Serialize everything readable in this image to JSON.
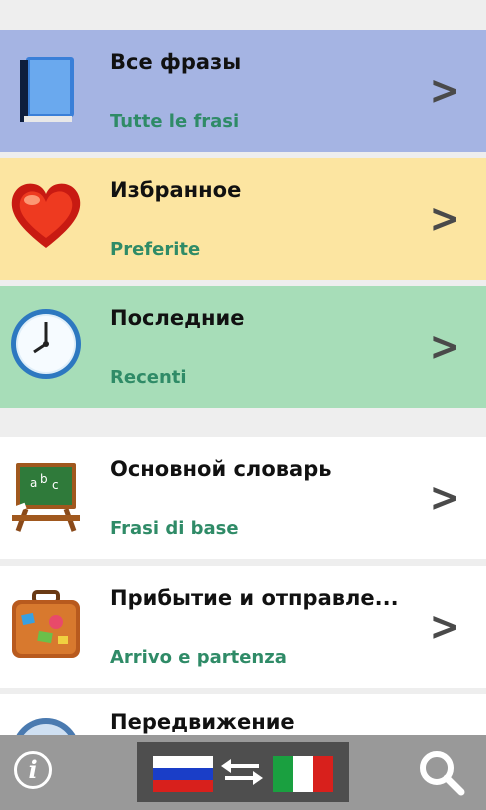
{
  "list": [
    {
      "title": "Все фразы",
      "subtitle": "Tutte le frasi",
      "icon": "book-icon"
    },
    {
      "title": "Избранное",
      "subtitle": "Preferite",
      "icon": "heart-icon"
    },
    {
      "title": "Последние",
      "subtitle": "Recenti",
      "icon": "clock-icon"
    },
    {
      "title": "Основной словарь",
      "subtitle": "Frasi di base",
      "icon": "chalkboard-icon"
    },
    {
      "title": "Прибытие и отправле...",
      "subtitle": "Arrivo e partenza",
      "icon": "suitcase-icon"
    },
    {
      "title": "Передвижение",
      "subtitle": "",
      "icon": "compass-icon"
    }
  ],
  "chevron": ">",
  "bottombar": {
    "info_label": "i",
    "language_pair": [
      "ru-flag-icon",
      "it-flag-icon"
    ],
    "search_icon": "magnifier-icon"
  },
  "colors": {
    "all_phrases_bg": "#a5b4e3",
    "favorites_bg": "#fce5a1",
    "recent_bg": "#a7ddb8",
    "subtitle": "#2f8b67",
    "bottombar_bg": "#999999"
  }
}
